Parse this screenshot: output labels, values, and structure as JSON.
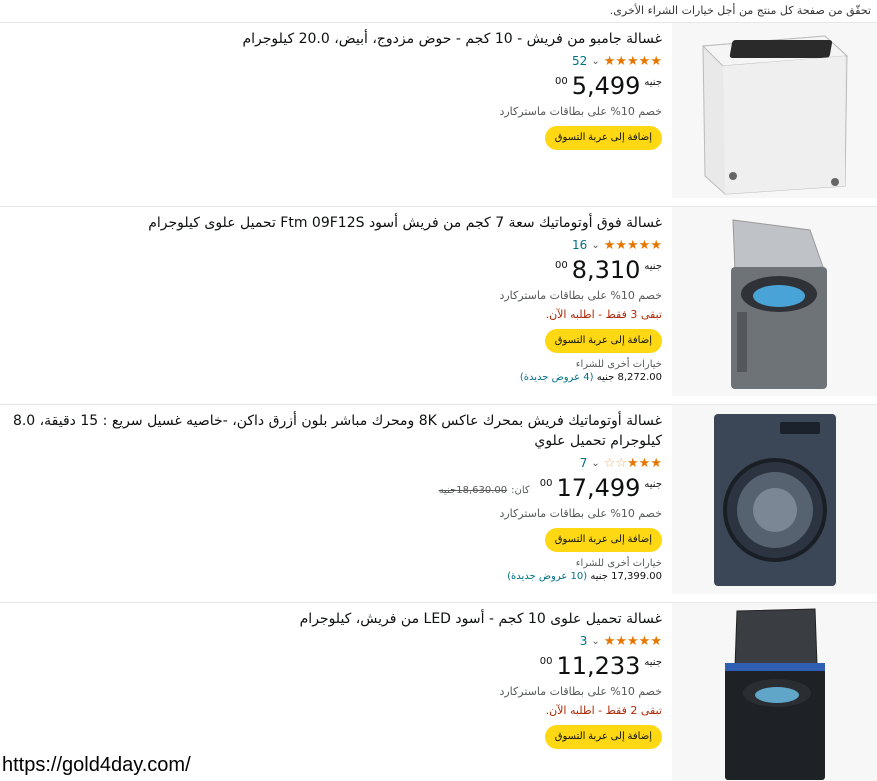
{
  "top_note": "تحقّق من صفحة كل منتج من أجل خيارات الشراء الأخرى.",
  "products": [
    {
      "title": "غسالة جامبو من فريش - 10 كجم - حوض مزدوج، أبيض، 20.0 كيلوجرام",
      "stars": "★★★★★",
      "stars_empty": "",
      "rating_count": "52",
      "currency": "جنيه",
      "price_whole": "5,499",
      "price_fraction": "00",
      "promo": "خصم 10% على بطاقات ماستركارد",
      "cart_label": "إضافة إلى عربة التسوق"
    },
    {
      "title": "غسالة فوق أوتوماتيك سعة 7 كجم من فريش أسود Ftm 09F12S تحميل علوى كيلوجرام",
      "stars": "★★★★★",
      "stars_empty": "",
      "rating_count": "16",
      "currency": "جنيه",
      "price_whole": "8,310",
      "price_fraction": "00",
      "promo": "خصم 10% على بطاقات ماستركارد",
      "stock": "تبقى 3 فقط - اطلبه الآن.",
      "cart_label": "إضافة إلى عربة التسوق",
      "other_label": "خيارات أخرى للشراء",
      "other_price": "8,272.00 جنيه",
      "other_offers": "(4 عروض جديدة)"
    },
    {
      "title": "غسالة أوتوماتيك فريش بمحرك عاكس 8K ومحرك مباشر بلون أزرق داكن، -خاصيه غسيل سريع : 15 دقيقة، 8.0 كيلوجرام تحميل علوي",
      "stars": "★★★",
      "stars_empty": "☆☆",
      "rating_count": "7",
      "currency": "جنيه",
      "price_whole": "17,499",
      "price_fraction": "00",
      "was_label": "كان:",
      "was_price": "18,630.00جنيه",
      "promo": "خصم 10% على بطاقات ماستركارد",
      "cart_label": "إضافة إلى عربة التسوق",
      "other_label": "خيارات أخرى للشراء",
      "other_price": "17,399.00 جنيه",
      "other_offers": "(10 عروض جديدة)"
    },
    {
      "title": "غسالة تحميل علوى 10 كجم - أسود LED من فريش، كيلوجرام",
      "stars": "★★★★★",
      "stars_empty": "",
      "rating_count": "3",
      "currency": "جنيه",
      "price_whole": "11,233",
      "price_fraction": "00",
      "promo": "خصم 10% على بطاقات ماستركارد",
      "stock": "تبقى 2 فقط - اطلبه الآن.",
      "cart_label": "إضافة إلى عربة التسوق"
    }
  ],
  "watermark": "https://gold4day.com/",
  "colors": {
    "star": "#e77600",
    "cart_button": "#ffd814",
    "link": "#007185",
    "stock": "#b12704"
  }
}
